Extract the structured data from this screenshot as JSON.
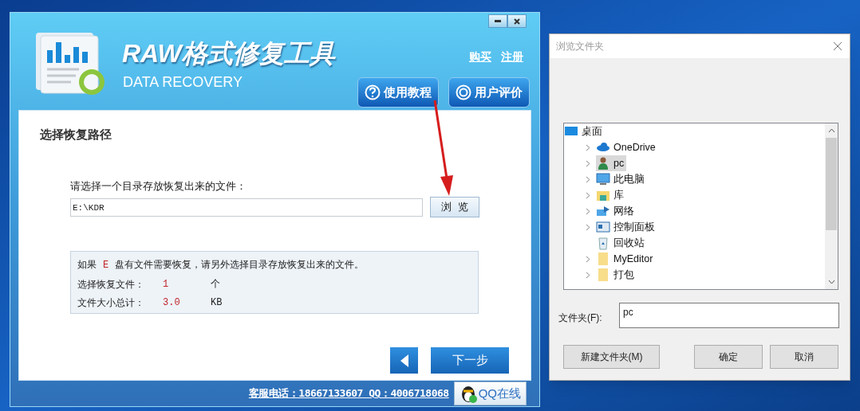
{
  "app": {
    "title": "RAW格式修复工具",
    "subtitle": "DATA RECOVERY",
    "top_links": [
      "购买",
      "注册"
    ],
    "header_buttons": [
      "使用教程",
      "用户评价"
    ],
    "section_title": "选择恢复路径",
    "path_label": "请选择一个目录存放恢复出来的文件：",
    "path_value": "E:\\KDR",
    "browse_button": "浏  览",
    "info": {
      "line_parts": [
        "如果",
        "E",
        "盘有文件需要恢复，请另外选择目录存放恢复出来的文件。"
      ],
      "rows": [
        {
          "label": "选择恢复文件：",
          "value": "1",
          "unit": "个"
        },
        {
          "label": "文件大小总计：",
          "value": "3.0",
          "unit": "KB"
        }
      ]
    },
    "next_button": "下一步",
    "footer_contact": "客服电话：18667133607 QQ：4006718068",
    "qq_button": "QQ在线"
  },
  "dialog": {
    "title": "浏览文件夹",
    "tree": [
      {
        "label": "桌面",
        "expandable": false,
        "selected": false,
        "children": [
          {
            "label": "OneDrive",
            "expandable": true,
            "selected": false
          },
          {
            "label": "pc",
            "expandable": true,
            "selected": true
          },
          {
            "label": "此电脑",
            "expandable": true,
            "selected": false
          },
          {
            "label": "库",
            "expandable": true,
            "selected": false
          },
          {
            "label": "网络",
            "expandable": true,
            "selected": false
          },
          {
            "label": "控制面板",
            "expandable": true,
            "selected": false
          },
          {
            "label": "回收站",
            "expandable": false,
            "selected": false
          },
          {
            "label": "MyEditor",
            "expandable": true,
            "selected": false
          },
          {
            "label": "打包",
            "expandable": true,
            "selected": false
          }
        ]
      }
    ],
    "folder_label": "文件夹(F):",
    "folder_value": "pc",
    "buttons": [
      "新建文件夹(M)",
      "确定",
      "取消"
    ]
  }
}
